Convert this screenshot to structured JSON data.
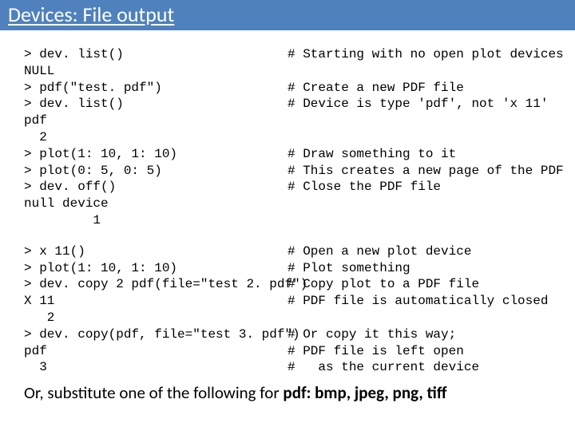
{
  "title": "Devices: File output",
  "block1": [
    {
      "code": "> dev. list()",
      "comment": "# Starting with no open plot devices"
    },
    {
      "code": "NULL",
      "comment": ""
    },
    {
      "code": "> pdf(\"test. pdf\")",
      "comment": "# Create a new PDF file"
    },
    {
      "code": "> dev. list()",
      "comment": "# Device is type 'pdf', not 'x 11'"
    },
    {
      "code": "pdf",
      "comment": ""
    },
    {
      "code": "  2",
      "comment": ""
    },
    {
      "code": "> plot(1: 10, 1: 10)",
      "comment": "# Draw something to it"
    },
    {
      "code": "> plot(0: 5, 0: 5)",
      "comment": "# This creates a new page of the PDF"
    },
    {
      "code": "> dev. off()",
      "comment": "# Close the PDF file"
    },
    {
      "code": "null device",
      "comment": ""
    },
    {
      "code": "         1",
      "comment": ""
    }
  ],
  "block2": [
    {
      "code": "> x 11()",
      "comment": "# Open a new plot device"
    },
    {
      "code": "> plot(1: 10, 1: 10)",
      "comment": "# Plot something"
    },
    {
      "code": "> dev. copy 2 pdf(file=\"test 2. pdf\")",
      "comment": "# Copy plot to a PDF file"
    },
    {
      "code": "X 11",
      "comment": "# PDF file is automatically closed"
    },
    {
      "code": "   2",
      "comment": ""
    },
    {
      "code": "> dev. copy(pdf, file=\"test 3. pdf\")",
      "comment": "# Or copy it this way;"
    },
    {
      "code": "pdf",
      "comment": "# PDF file is left open"
    },
    {
      "code": "  3",
      "comment": "#   as the current device"
    }
  ],
  "footer_prefix": "Or, substitute one of the following for ",
  "footer_bold": "pdf: bmp, jpeg, png, tiff"
}
